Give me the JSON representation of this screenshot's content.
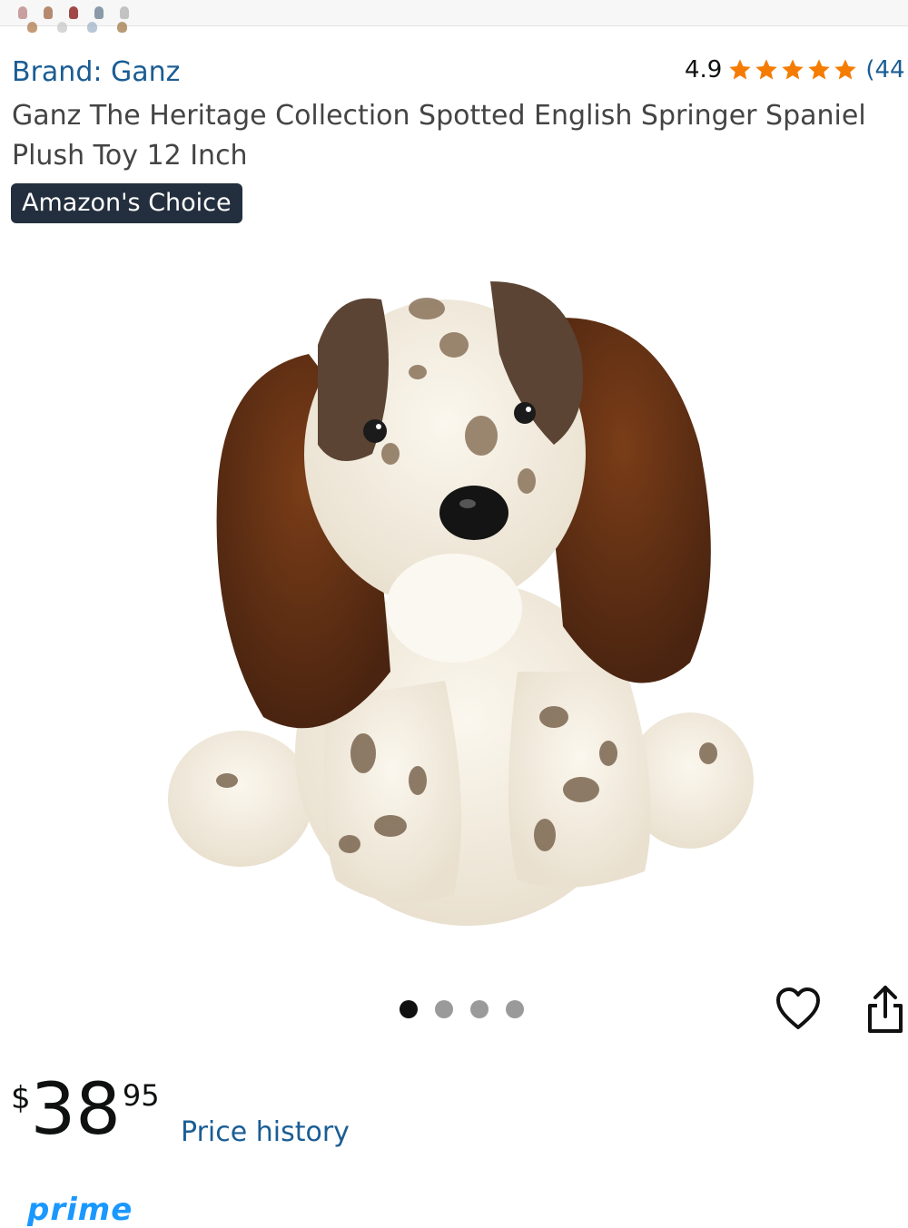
{
  "product": {
    "brand": "Brand: Ganz",
    "rating": "4.9",
    "rating_stars": 5,
    "review_count": "(44",
    "title": "Ganz The Heritage Collection Spotted English Springer Spaniel Plush Toy 12 Inch",
    "badge": "Amazon's Choice",
    "image_icon": "springer-spaniel-plush-photo"
  },
  "gallery": {
    "image_count": 4,
    "current_index": 1
  },
  "actions": {
    "favorite_icon": "heart-icon",
    "share_icon": "share-icon"
  },
  "price": {
    "symbol": "$",
    "whole": "38",
    "fraction": "95",
    "history_link": "Price history"
  },
  "prime_label": "prime",
  "colors": {
    "link": "#1a5d94",
    "star": "#f57c00",
    "badge_bg": "#232f3e",
    "prime": "#1a98ff"
  }
}
